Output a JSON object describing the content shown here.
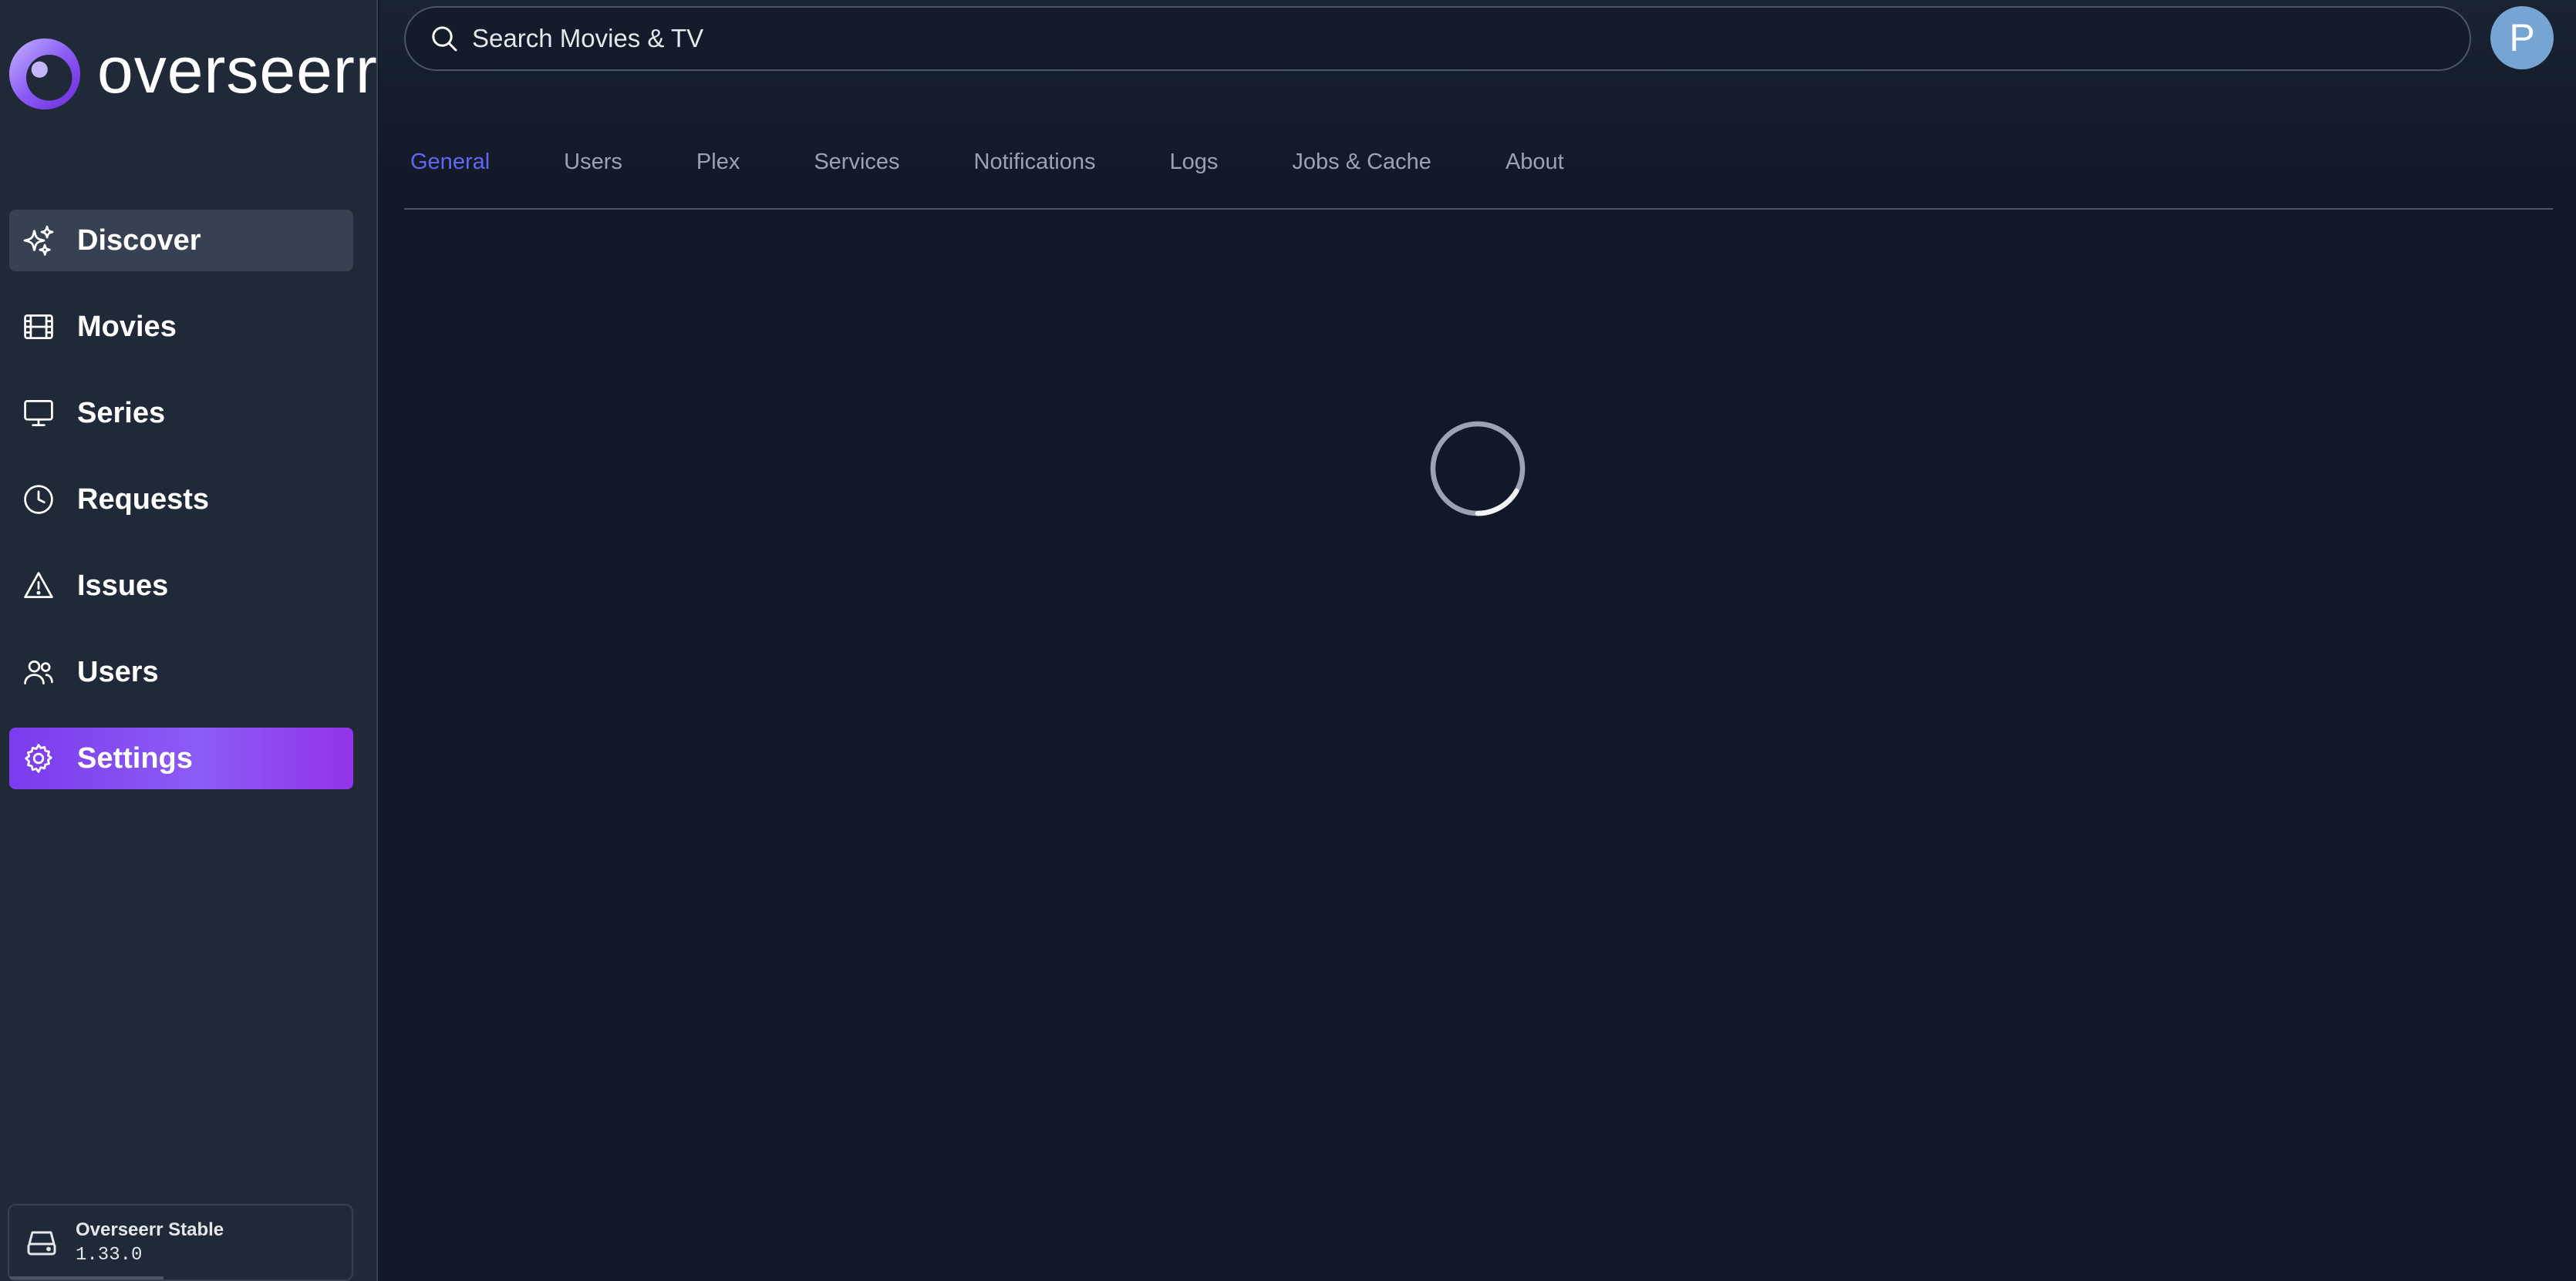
{
  "app": {
    "logo_text": "overseerr"
  },
  "sidebar": {
    "items": [
      {
        "label": "Discover",
        "icon": "sparkles-icon"
      },
      {
        "label": "Movies",
        "icon": "film-icon"
      },
      {
        "label": "Series",
        "icon": "tv-icon"
      },
      {
        "label": "Requests",
        "icon": "clock-icon"
      },
      {
        "label": "Issues",
        "icon": "warning-icon"
      },
      {
        "label": "Users",
        "icon": "users-icon"
      },
      {
        "label": "Settings",
        "icon": "gear-icon"
      }
    ],
    "active": "Settings",
    "hovered": "Discover",
    "version": {
      "name": "Overseerr Stable",
      "number": "1.33.0",
      "icon": "server-icon"
    }
  },
  "header": {
    "search_placeholder": "Search Movies & TV",
    "avatar_initial": "P"
  },
  "settings": {
    "tabs": [
      "General",
      "Users",
      "Plex",
      "Services",
      "Notifications",
      "Logs",
      "Jobs & Cache",
      "About"
    ],
    "active_tab": "General"
  },
  "colors": {
    "background": "#111827",
    "sidebar": "#1f2937",
    "accent": "#8b5cf6",
    "tab_active": "#6366f1",
    "avatar": "#76a5d4"
  }
}
